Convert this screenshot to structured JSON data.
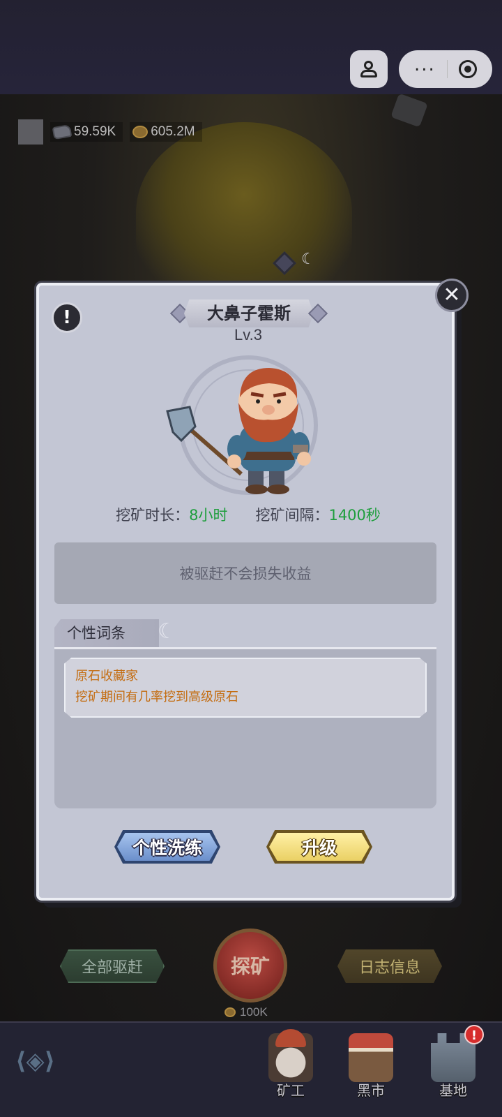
{
  "hud": {
    "ore_count": "59.59K",
    "gold_count": "605.2M"
  },
  "modal": {
    "character_name": "大鼻子霍斯",
    "level": "Lv.3",
    "stats": {
      "mining_duration_label": "挖矿时长：",
      "mining_duration_value": "8小时",
      "mining_interval_label": "挖矿间隔：",
      "mining_interval_value": "1400秒"
    },
    "notice": "被驱赶不会损失收益",
    "traits": {
      "tab_label": "个性词条",
      "items": [
        {
          "name": "原石收藏家",
          "description": "挖矿期间有几率挖到高级原石"
        }
      ]
    },
    "buttons": {
      "reroll_label": "个性洗练",
      "upgrade_label": "升级"
    },
    "close_icon": "close-icon",
    "info_icon": "info-icon"
  },
  "background_actions": {
    "evict_all_label": "全部驱赶",
    "explore_label": "探矿",
    "explore_cost": "100K",
    "log_label": "日志信息"
  },
  "bottom_nav": {
    "tabs": [
      {
        "label": "矿工",
        "icon": "miner-icon"
      },
      {
        "label": "黑市",
        "icon": "market-stall-icon"
      },
      {
        "label": "基地",
        "icon": "castle-icon",
        "badge": "!"
      }
    ]
  },
  "colors": {
    "stat_value": "#1d9e3c",
    "trait_text": "#c46d12",
    "reroll_button": "#6b8fcb",
    "upgrade_button": "#ead064"
  }
}
